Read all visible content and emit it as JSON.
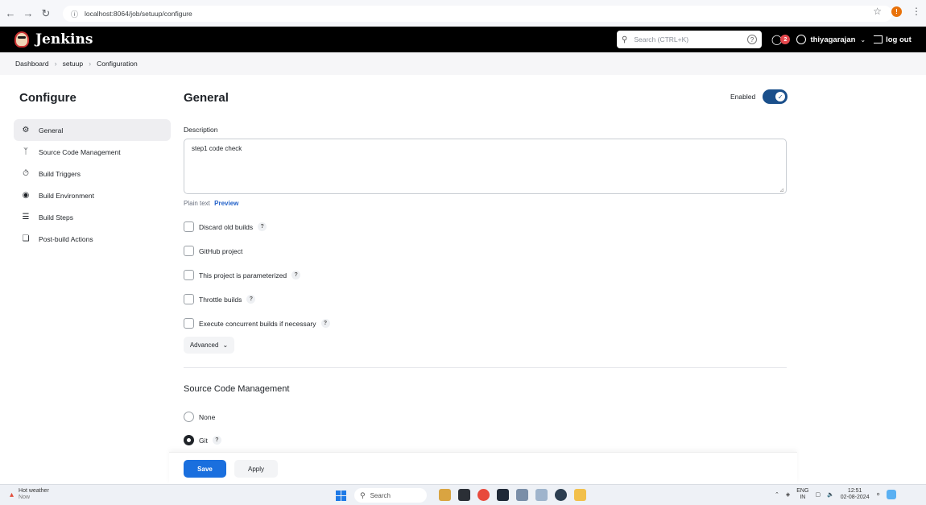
{
  "browser": {
    "url": "localhost:8064/job/setuup/configure"
  },
  "header": {
    "app_name": "Jenkins",
    "search_placeholder": "Search (CTRL+K)",
    "help": "?",
    "badge_count": "2",
    "username": "thiyagarajan",
    "logout_label": "log out"
  },
  "breadcrumb": [
    "Dashboard",
    "setuup",
    "Configuration"
  ],
  "sidebar": {
    "title": "Configure",
    "items": [
      {
        "label": "General",
        "icon": "gear-icon"
      },
      {
        "label": "Source Code Management",
        "icon": "branch-icon"
      },
      {
        "label": "Build Triggers",
        "icon": "timer-icon"
      },
      {
        "label": "Build Environment",
        "icon": "globe-icon"
      },
      {
        "label": "Build Steps",
        "icon": "list-icon"
      },
      {
        "label": "Post-build Actions",
        "icon": "box-icon"
      }
    ]
  },
  "general": {
    "title": "General",
    "enabled_label": "Enabled",
    "description_label": "Description",
    "description_value": "step1 code check",
    "plain_text": "Plain text",
    "preview": "Preview",
    "help": "?",
    "options": [
      {
        "label": "Discard old builds",
        "help": true
      },
      {
        "label": "GitHub project",
        "help": false
      },
      {
        "label": "This project is parameterized",
        "help": true
      },
      {
        "label": "Throttle builds",
        "help": true
      },
      {
        "label": "Execute concurrent builds if necessary",
        "help": true
      }
    ],
    "advanced_label": "Advanced"
  },
  "scm": {
    "title": "Source Code Management",
    "options": [
      {
        "label": "None",
        "selected": false
      },
      {
        "label": "Git",
        "selected": true
      }
    ]
  },
  "actions": {
    "save": "Save",
    "apply": "Apply"
  },
  "taskbar": {
    "weather_title": "Hot weather",
    "weather_sub": "Now",
    "search_label": "Search",
    "lang": "ENG",
    "region": "IN",
    "time": "12:51",
    "date": "02-08-2024"
  },
  "colors": {
    "accent": "#1a6fde",
    "toggle": "#1a4f8b",
    "header_bg": "#000000"
  }
}
